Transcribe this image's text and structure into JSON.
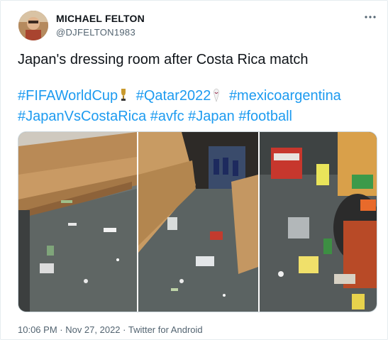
{
  "author": {
    "name": "MICHAEL FELTON",
    "handle": "@DJFELTON1983"
  },
  "more_icon": "more-horizontal-icon",
  "tweet": {
    "text": "Japan's dressing room after Costa Rica match",
    "hashtags": [
      "#FIFAWorldCup",
      "#Qatar2022",
      "#mexicoargentina",
      "#JapanVsCostaRica",
      "#avfc",
      "#Japan",
      "#football"
    ],
    "emojis": [
      "trophy-emoji",
      "world-cup-mascot-emoji"
    ]
  },
  "media": {
    "description_panels": [
      "locker-room-bench-left",
      "locker-room-bench-center",
      "trash-bin-closeup"
    ]
  },
  "meta": {
    "footer": "10:06 PM · Nov 27, 2022 · Twitter for Android"
  }
}
